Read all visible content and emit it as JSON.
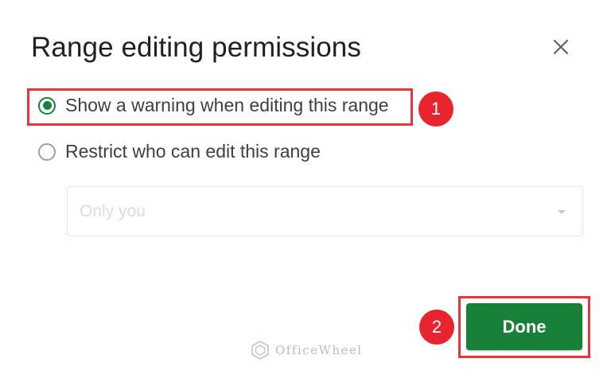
{
  "dialog": {
    "title": "Range editing permissions",
    "close_icon": "close-icon"
  },
  "options": [
    {
      "label": "Show a warning when editing this range",
      "checked": true
    },
    {
      "label": "Restrict who can edit this range",
      "checked": false
    }
  ],
  "select": {
    "value": "Only you",
    "disabled": true,
    "arrow_icon": "dropdown-arrow-icon"
  },
  "done_button": {
    "label": "Done"
  },
  "annotations": {
    "step1": "1",
    "step2": "2"
  },
  "watermark": {
    "text": "OfficeWheel"
  },
  "colors": {
    "accent_green": "#188038",
    "annotation_red": "#e8343c",
    "text": "#202124",
    "disabled_text": "#dadce0"
  }
}
